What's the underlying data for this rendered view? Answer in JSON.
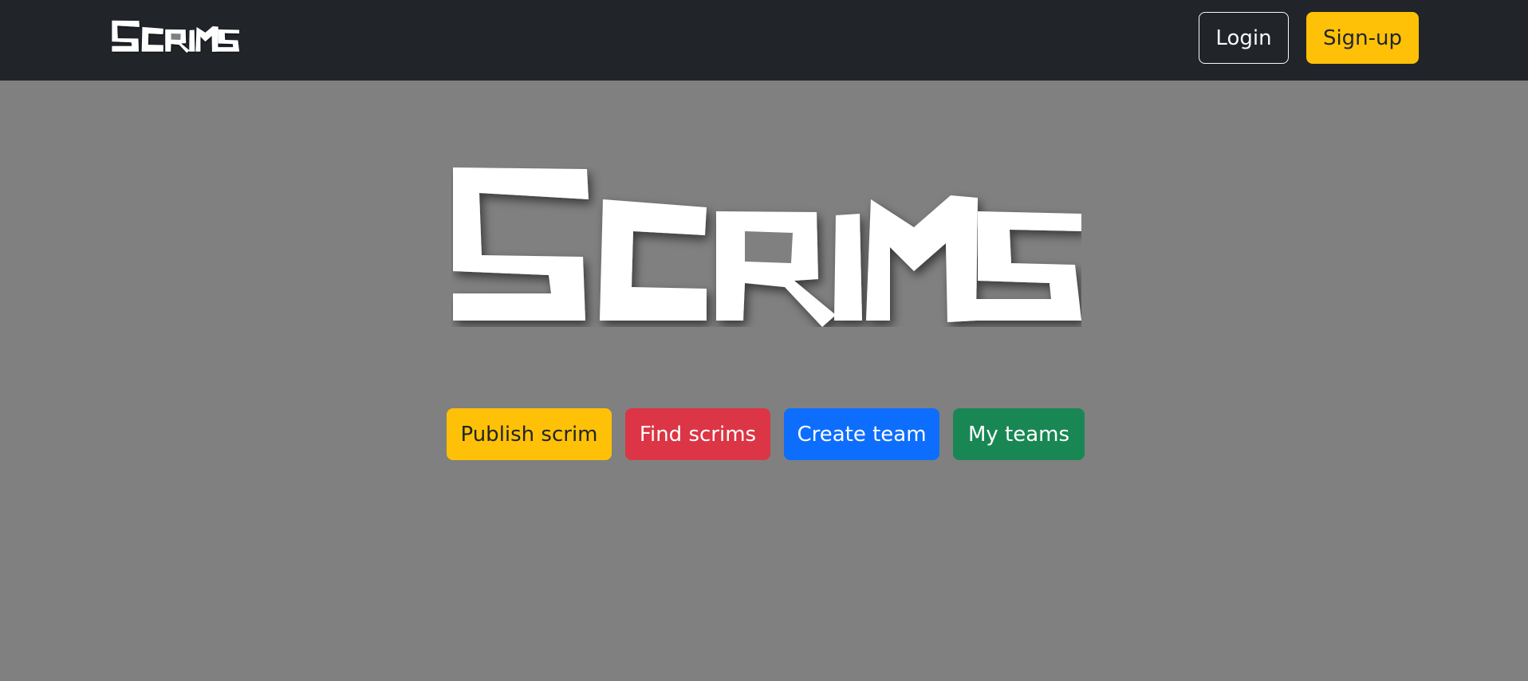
{
  "nav": {
    "logo_text": "Scrims",
    "login_label": "Login",
    "signup_label": "Sign-up"
  },
  "hero": {
    "logo_text": "Scrims"
  },
  "actions": {
    "publish_label": "Publish scrim",
    "find_label": "Find scrims",
    "create_label": "Create team",
    "myteams_label": "My teams"
  },
  "colors": {
    "navbar_bg": "#212529",
    "page_bg": "#808080",
    "warning": "#ffc107",
    "danger": "#dc3545",
    "primary": "#0d6efd",
    "success": "#198754"
  }
}
